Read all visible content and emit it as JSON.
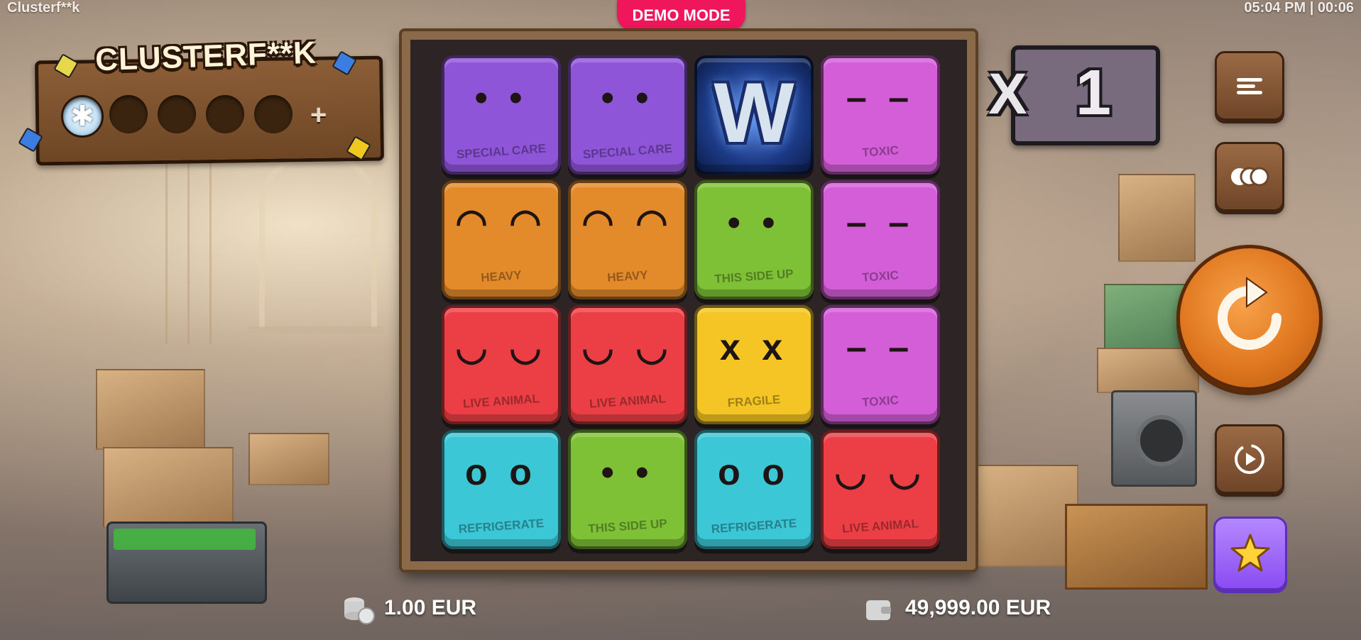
{
  "app": {
    "title": "Clusterf**k",
    "clock": "05:04 PM | 00:06"
  },
  "demo_badge": "DEMO MODE",
  "logo": {
    "text": "CLUSTERF**K",
    "collect_slots": [
      {
        "state": "collected",
        "icon": "star-shape-icon"
      },
      {
        "state": "empty"
      },
      {
        "state": "empty"
      },
      {
        "state": "empty"
      },
      {
        "state": "empty"
      }
    ],
    "plus": "+"
  },
  "multiplier": {
    "prefix": "X",
    "value": "1"
  },
  "grid": {
    "rows": [
      [
        {
          "symbol": "special-care",
          "label": "SPECIAL CARE",
          "color": "#8f55d8",
          "face": "• •"
        },
        {
          "symbol": "special-care",
          "label": "SPECIAL CARE",
          "color": "#8f55d8",
          "face": "• •"
        },
        {
          "symbol": "wild",
          "label": "W",
          "color": "#1c3a86",
          "face": ""
        },
        {
          "symbol": "toxic",
          "label": "TOXIC",
          "color": "#d45ed8",
          "face": "– –"
        }
      ],
      [
        {
          "symbol": "heavy",
          "label": "HEAVY",
          "color": "#e38a2b",
          "face": "◠ ◠"
        },
        {
          "symbol": "heavy",
          "label": "HEAVY",
          "color": "#e38a2b",
          "face": "◠ ◠"
        },
        {
          "symbol": "this-side-up",
          "label": "THIS SIDE UP",
          "color": "#7fc136",
          "face": "• •"
        },
        {
          "symbol": "toxic",
          "label": "TOXIC",
          "color": "#d45ed8",
          "face": "– –"
        }
      ],
      [
        {
          "symbol": "live-animal",
          "label": "LIVE ANIMAL",
          "color": "#ec3f45",
          "face": "◡ ◡"
        },
        {
          "symbol": "live-animal",
          "label": "LIVE ANIMAL",
          "color": "#ec3f45",
          "face": "◡ ◡"
        },
        {
          "symbol": "fragile",
          "label": "FRAGILE",
          "color": "#f4c524",
          "face": "x x"
        },
        {
          "symbol": "toxic",
          "label": "TOXIC",
          "color": "#d45ed8",
          "face": "– –"
        }
      ],
      [
        {
          "symbol": "refrigerate",
          "label": "REFRIGERATE",
          "color": "#3cc7d6",
          "face": "o o"
        },
        {
          "symbol": "this-side-up",
          "label": "THIS SIDE UP",
          "color": "#7fc136",
          "face": "• •"
        },
        {
          "symbol": "refrigerate",
          "label": "REFRIGERATE",
          "color": "#3cc7d6",
          "face": "o o"
        },
        {
          "symbol": "live-animal",
          "label": "LIVE ANIMAL",
          "color": "#ec3f45",
          "face": "◡ ◡"
        }
      ]
    ]
  },
  "controls": {
    "menu_icon": "hamburger-icon",
    "bet_chips_icon": "chips-icon",
    "spin_icon": "refresh-arrow-icon",
    "autoplay_icon": "autoplay-icon",
    "bonus_icon": "star-icon"
  },
  "footer": {
    "bet": "1.00 EUR",
    "balance": "49,999.00 EUR"
  },
  "colors": {
    "demo_badge": "#f0165c",
    "spin_button": "#e07820",
    "bonus_button": "#8a4df2",
    "multiplier_box": "#786b7e"
  }
}
